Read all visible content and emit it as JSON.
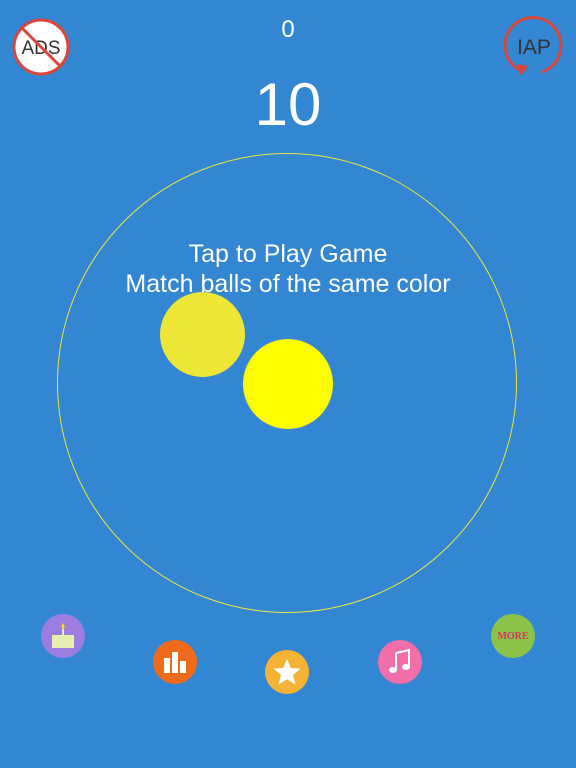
{
  "hud": {
    "top_score": "0",
    "current_score": "10",
    "no_ads_label": "ADS",
    "iap_label": "IAP"
  },
  "instructions": {
    "line1": "Tap to Play Game",
    "line2": "Match balls of the same color"
  },
  "colors": {
    "background": "#3386d1",
    "ring": "#e8e840",
    "ball_left": "#ede637",
    "ball_center": "#ffff00",
    "no_ads_accent": "#d9453b",
    "iap_accent": "#d9453b"
  },
  "bottom_bar": {
    "items": [
      {
        "icon": "candle-icon",
        "color": "#9b7ee0"
      },
      {
        "icon": "leaderboard-icon",
        "color": "#f06a1c"
      },
      {
        "icon": "star-icon",
        "color": "#f5b335"
      },
      {
        "icon": "music-note-icon",
        "color": "#f16eaa"
      },
      {
        "icon": "more-icon",
        "color": "#8bc34a",
        "label": "MORE"
      }
    ]
  }
}
